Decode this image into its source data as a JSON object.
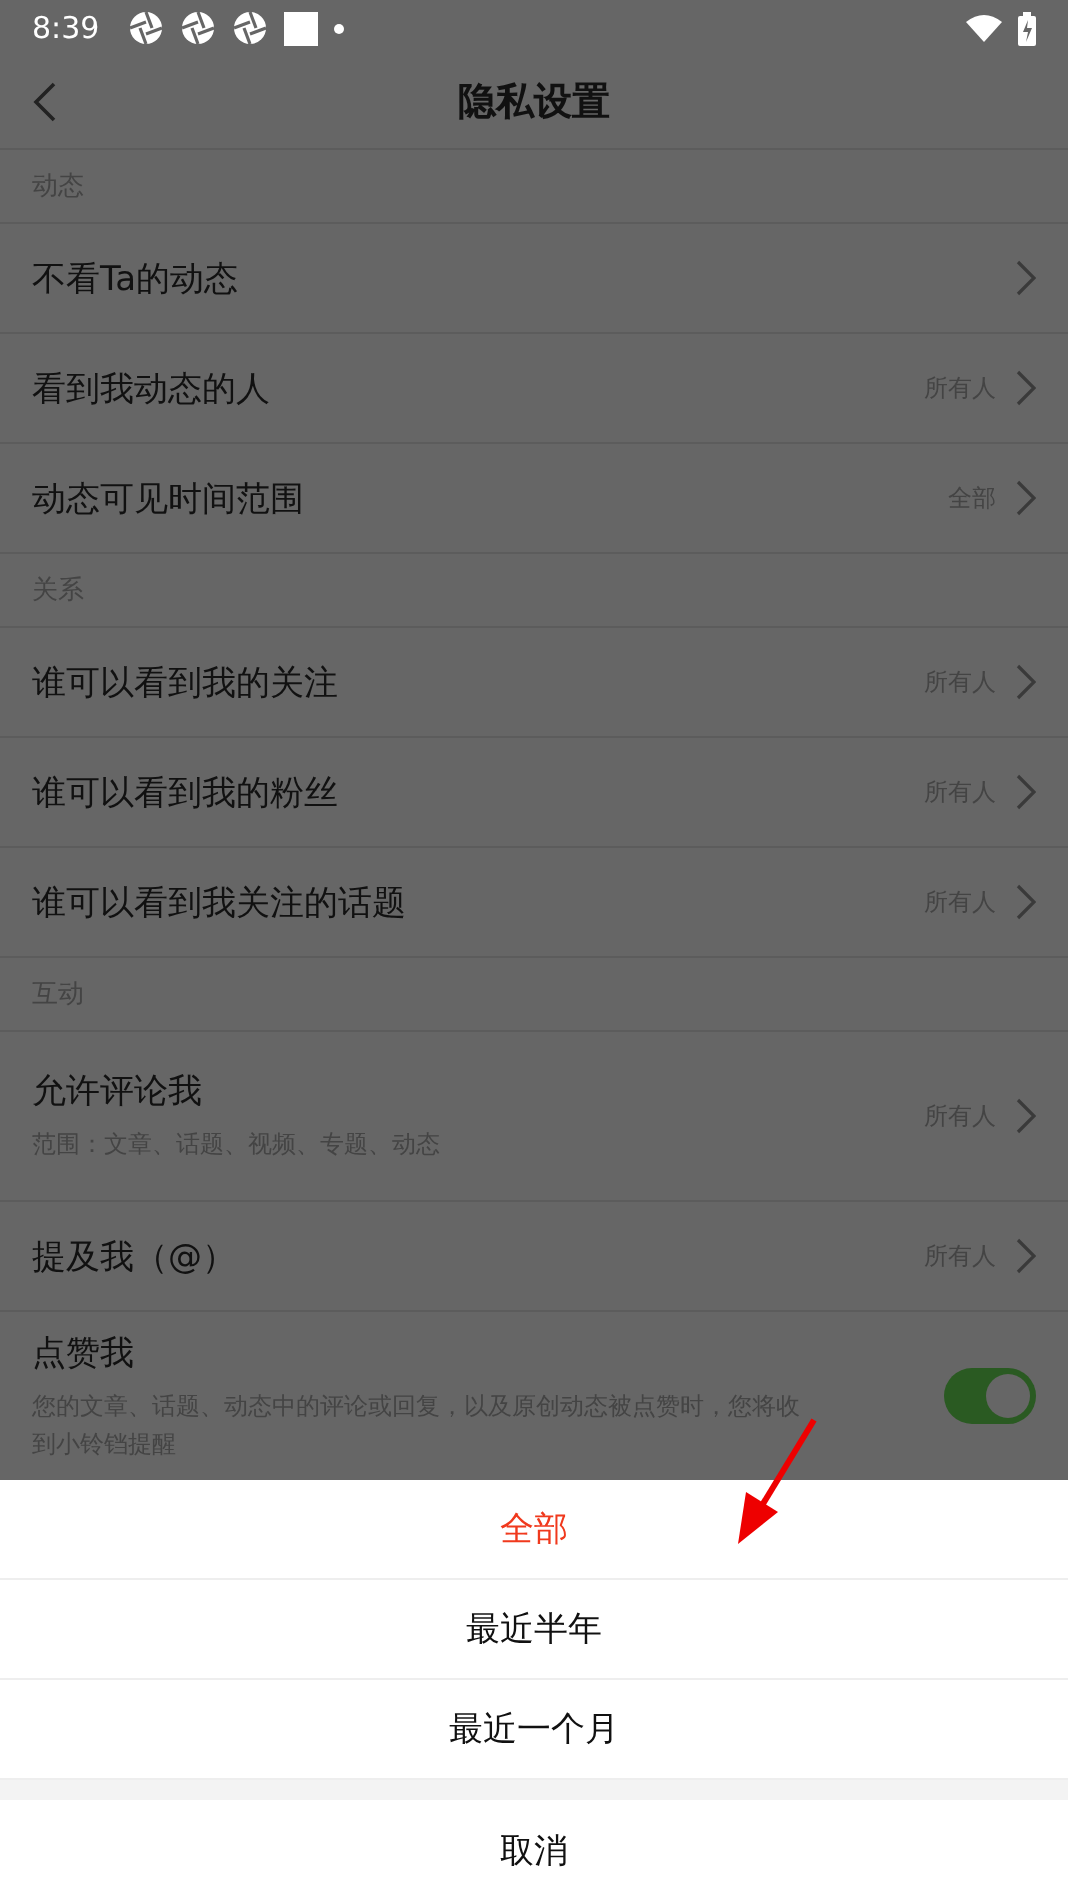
{
  "status_bar": {
    "time": "8:39"
  },
  "header": {
    "title": "隐私设置"
  },
  "sections": [
    {
      "title": "动态",
      "items": [
        {
          "kind": "link",
          "label": "不看Ta的动态"
        },
        {
          "kind": "link",
          "label": "看到我动态的人",
          "value": "所有人"
        },
        {
          "kind": "link",
          "label": "动态可见时间范围",
          "value": "全部"
        }
      ]
    },
    {
      "title": "关系",
      "items": [
        {
          "kind": "link",
          "label": "谁可以看到我的关注",
          "value": "所有人"
        },
        {
          "kind": "link",
          "label": "谁可以看到我的粉丝",
          "value": "所有人"
        },
        {
          "kind": "link",
          "label": "谁可以看到我关注的话题",
          "value": "所有人"
        }
      ]
    },
    {
      "title": "互动",
      "items": [
        {
          "kind": "link",
          "label": "允许评论我",
          "description": "范围：文章、话题、视频、专题、动态",
          "value": "所有人"
        },
        {
          "kind": "link",
          "label": "提及我（@）",
          "value": "所有人"
        },
        {
          "kind": "toggle",
          "label": "点赞我",
          "description": "您的文章、话题、动态中的评论或回复，以及原创动态被点赞时，您将收到小铃铛提醒",
          "on": true
        }
      ]
    }
  ],
  "sheet": {
    "options": [
      {
        "label": "全部",
        "selected": true
      },
      {
        "label": "最近半年",
        "selected": false
      },
      {
        "label": "最近一个月",
        "selected": false
      }
    ],
    "cancel": "取消"
  }
}
